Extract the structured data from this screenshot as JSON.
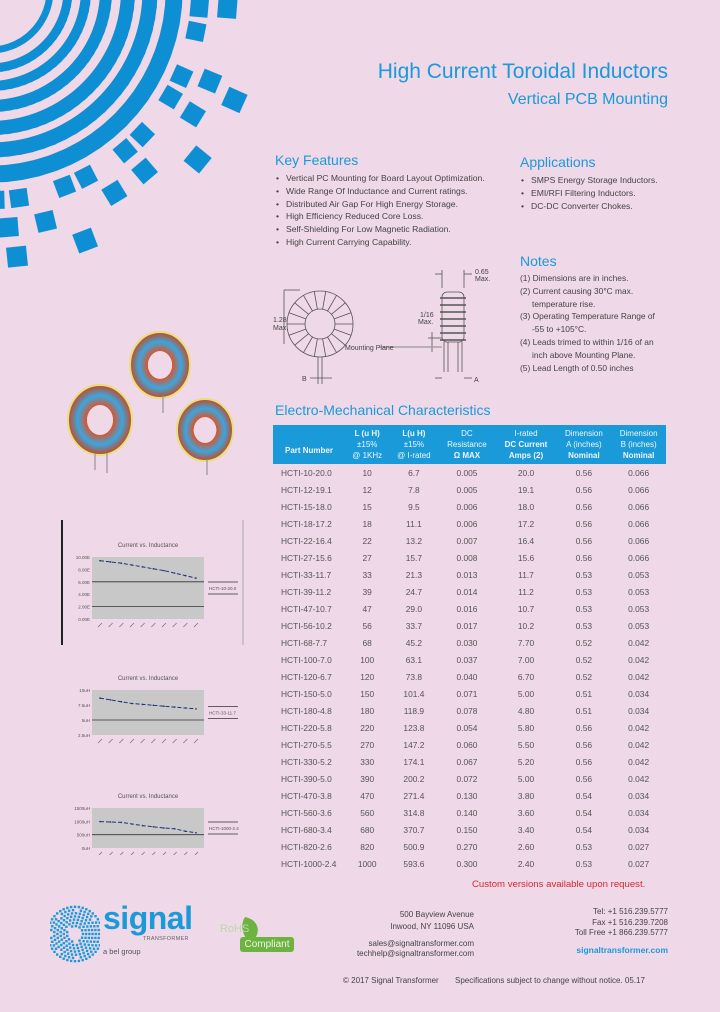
{
  "header": {
    "title": "High Current Toroidal Inductors",
    "subtitle": "Vertical PCB Mounting"
  },
  "key_features": {
    "heading": "Key Features",
    "items": [
      "Vertical PC Mounting for Board Layout Optimization.",
      "Wide Range Of Inductance and Current ratings.",
      "Distributed Air Gap For High Energy Storage.",
      "High Efficiency Reduced Core Loss.",
      "Self-Shielding For Low Magnetic Radiation.",
      "High Current Carrying Capability."
    ]
  },
  "applications": {
    "heading": "Applications",
    "items": [
      "SMPS Energy Storage Inductors.",
      "EMI/RFI Filtering Inductors.",
      "DC-DC Converter Chokes."
    ]
  },
  "notes": {
    "heading": "Notes",
    "lines": [
      {
        "text": "(1) Dimensions are in inches.",
        "indent": false
      },
      {
        "text": "(2) Current causing 30°C max.",
        "indent": false
      },
      {
        "text": "temperature rise.",
        "indent": true
      },
      {
        "text": "(3) Operating Temperature Range of",
        "indent": false
      },
      {
        "text": "-55 to +105°C.",
        "indent": true
      },
      {
        "text": "(4) Leads trimed to within 1/16 of an",
        "indent": false
      },
      {
        "text": "inch above Mounting Plane.",
        "indent": true
      },
      {
        "text": "(5) Lead Length of 0.50 inches",
        "indent": false
      }
    ]
  },
  "diagram": {
    "height_label": "1.28",
    "height_sub": "Max.",
    "width_label": "0.65",
    "width_sub": "Max.",
    "gap_label": "1/16",
    "gap_sub": "Max.",
    "mounting_plane": "Mounting Plane",
    "dim_a": "A",
    "dim_b": "B"
  },
  "table": {
    "heading": "Electro-Mechanical Characteristics",
    "headers": [
      [
        "",
        "Part Number",
        ""
      ],
      [
        "L (u H)",
        "±15%",
        "@ 1KHz"
      ],
      [
        "L(u H)",
        "±15%",
        "@ I-rated"
      ],
      [
        "DC",
        "Resistance",
        "Ω MAX"
      ],
      [
        "I-rated",
        "DC Current",
        "Amps (2)"
      ],
      [
        "Dimension",
        "A (inches)",
        "Nominal"
      ],
      [
        "Dimension",
        "B (inches)",
        "Nominal"
      ]
    ],
    "rows": [
      [
        "HCTI-10-20.0",
        "10",
        "6.7",
        "0.005",
        "20.0",
        "0.56",
        "0.066"
      ],
      [
        "HCTI-12-19.1",
        "12",
        "7.8",
        "0.005",
        "19.1",
        "0.56",
        "0.066"
      ],
      [
        "HCTI-15-18.0",
        "15",
        "9.5",
        "0.006",
        "18.0",
        "0.56",
        "0.066"
      ],
      [
        "HCTI-18-17.2",
        "18",
        "11.1",
        "0.006",
        "17.2",
        "0.56",
        "0.066"
      ],
      [
        "HCTI-22-16.4",
        "22",
        "13.2",
        "0.007",
        "16.4",
        "0.56",
        "0.066"
      ],
      [
        "HCTI-27-15.6",
        "27",
        "15.7",
        "0.008",
        "15.6",
        "0.56",
        "0.066"
      ],
      [
        "HCTI-33-11.7",
        "33",
        "21.3",
        "0.013",
        "11.7",
        "0.53",
        "0.053"
      ],
      [
        "HCTI-39-11.2",
        "39",
        "24.7",
        "0.014",
        "11.2",
        "0.53",
        "0.053"
      ],
      [
        "HCTI-47-10.7",
        "47",
        "29.0",
        "0.016",
        "10.7",
        "0.53",
        "0.053"
      ],
      [
        "HCTI-56-10.2",
        "56",
        "33.7",
        "0.017",
        "10.2",
        "0.53",
        "0.053"
      ],
      [
        "HCTI-68-7.7",
        "68",
        "45.2",
        "0.030",
        "7.70",
        "0.52",
        "0.042"
      ],
      [
        "HCTI-100-7.0",
        "100",
        "63.1",
        "0.037",
        "7.00",
        "0.52",
        "0.042"
      ],
      [
        "HCTI-120-6.7",
        "120",
        "73.8",
        "0.040",
        "6.70",
        "0.52",
        "0.042"
      ],
      [
        "HCTI-150-5.0",
        "150",
        "101.4",
        "0.071",
        "5.00",
        "0.51",
        "0.034"
      ],
      [
        "HCTI-180-4.8",
        "180",
        "118.9",
        "0.078",
        "4.80",
        "0.51",
        "0.034"
      ],
      [
        "HCTI-220-5.8",
        "220",
        "123.8",
        "0.054",
        "5.80",
        "0.56",
        "0.042"
      ],
      [
        "HCTI-270-5.5",
        "270",
        "147.2",
        "0.060",
        "5.50",
        "0.56",
        "0.042"
      ],
      [
        "HCTI-330-5.2",
        "330",
        "174.1",
        "0.067",
        "5.20",
        "0.56",
        "0.042"
      ],
      [
        "HCTI-390-5.0",
        "390",
        "200.2",
        "0.072",
        "5.00",
        "0.56",
        "0.042"
      ],
      [
        "HCTI-470-3.8",
        "470",
        "271.4",
        "0.130",
        "3.80",
        "0.54",
        "0.034"
      ],
      [
        "HCTI-560-3.6",
        "560",
        "314.8",
        "0.140",
        "3.60",
        "0.54",
        "0.034"
      ],
      [
        "HCTI-680-3.4",
        "680",
        "370.7",
        "0.150",
        "3.40",
        "0.54",
        "0.034"
      ],
      [
        "HCTI-820-2.6",
        "820",
        "500.9",
        "0.270",
        "2.60",
        "0.53",
        "0.027"
      ],
      [
        "HCTI-1000-2.4",
        "1000",
        "593.6",
        "0.300",
        "2.40",
        "0.53",
        "0.027"
      ]
    ],
    "footnote": "Custom versions available upon request."
  },
  "chart_data": [
    {
      "type": "line",
      "title": "Current vs. Inductance",
      "yticks": [
        "10.00E",
        "8.00E",
        "6.00E",
        "4.00E",
        "2.00E",
        "0.00E"
      ],
      "series": [
        {
          "name": "HCTI-10-20.0",
          "values": [
            0.94,
            0.92,
            0.9,
            0.87,
            0.84,
            0.81,
            0.78,
            0.74,
            0.7,
            0.66
          ]
        }
      ],
      "ylim": [
        0,
        1
      ]
    },
    {
      "type": "line",
      "title": "Current vs. Inductance",
      "yticks": [
        "10uH",
        "7.5uH",
        "5uH",
        "2.5uH"
      ],
      "series": [
        {
          "name": "HCTI-33-11.7",
          "values": [
            0.82,
            0.78,
            0.74,
            0.7,
            0.68,
            0.66,
            0.64,
            0.62,
            0.6,
            0.58
          ]
        }
      ],
      "ylim": [
        0,
        1
      ]
    },
    {
      "type": "line",
      "title": "Current vs. Inductance",
      "yticks": [
        "1500uH",
        "1000uH",
        "500uH",
        "0uH"
      ],
      "series": [
        {
          "name": "HCTI-1000-2.4",
          "values": [
            0.66,
            0.65,
            0.64,
            0.6,
            0.56,
            0.53,
            0.5,
            0.48,
            0.42,
            0.38
          ]
        }
      ],
      "ylim": [
        0,
        1
      ]
    }
  ],
  "footer": {
    "brand": "signal",
    "brand_sub": "TRANSFORMER",
    "group": "a bel group",
    "rohs_top": "RoHS",
    "rohs_bottom": "Compliant",
    "address1": "500 Bayview Avenue",
    "address2": "Inwood, NY 11096 USA",
    "email1": "sales@signaltransformer.com",
    "email2": "techhelp@signaltransformer.com",
    "tel": "Tel: +1 516.239.5777",
    "fax": "Fax +1 516.239.7208",
    "tollfree": "Toll Free +1 866.239.5777",
    "website": "signaltransformer.com",
    "copyright": "© 2017  Signal Transformer",
    "disclaimer": "Specifications subject to change without notice. 05.17"
  },
  "colors": {
    "accent": "#1a9ad9",
    "background": "#efd8e8",
    "custom_note": "#d8282e",
    "rohs_green": "#6cb33f"
  }
}
